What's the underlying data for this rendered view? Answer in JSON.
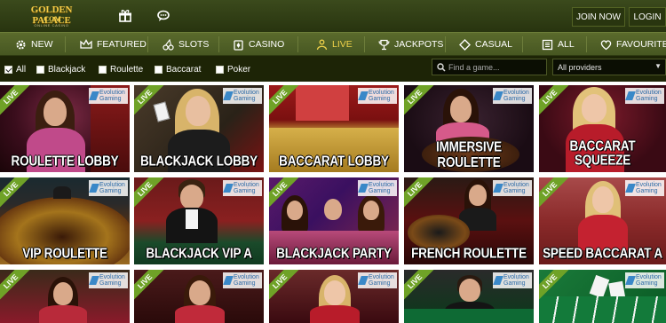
{
  "brand": {
    "line1": "GOLDEN PALACE",
    "line2": ".COM",
    "line3": "ONLINE CASINO"
  },
  "header": {
    "join_label": "JOIN NOW",
    "login_label": "LOGIN",
    "icons": [
      "gift-icon",
      "chat-icon"
    ]
  },
  "nav": {
    "items": [
      {
        "label": "NEW",
        "icon": "gear-icon"
      },
      {
        "label": "FEATURED",
        "icon": "crown-icon"
      },
      {
        "label": "SLOTS",
        "icon": "cherries-icon"
      },
      {
        "label": "CASINO",
        "icon": "cards-icon"
      },
      {
        "label": "LIVE",
        "icon": "dealer-icon",
        "active": true
      },
      {
        "label": "JACKPOTS",
        "icon": "trophy-icon"
      },
      {
        "label": "CASUAL",
        "icon": "diamond-icon"
      },
      {
        "label": "ALL",
        "icon": "list-icon"
      },
      {
        "label": "FAVOURITES",
        "icon": "heart-icon"
      }
    ]
  },
  "filters": {
    "options": [
      {
        "label": "All",
        "checked": true
      },
      {
        "label": "Blackjack",
        "checked": false
      },
      {
        "label": "Roulette",
        "checked": false
      },
      {
        "label": "Baccarat",
        "checked": false
      },
      {
        "label": "Poker",
        "checked": false
      }
    ],
    "search_placeholder": "Find a game...",
    "provider_selected": "All providers"
  },
  "tile_badge": {
    "live": "LIVE",
    "provider_line1": "Evolution",
    "provider_line2": "Gaming"
  },
  "games": {
    "row1": [
      "ROULETTE LOBBY",
      "BLACKJACK LOBBY",
      "BACCARAT LOBBY",
      "IMMERSIVE ROULETTE",
      "BACCARAT",
      "SQUEEZE"
    ],
    "row2": [
      "VIP ROULETTE",
      "BLACKJACK VIP A",
      "BLACKJACK PARTY",
      "FRENCH ROULETTE",
      "SPEED BACCARAT A"
    ]
  },
  "colors": {
    "header_bg": "#28340f",
    "nav_bg": "#4f5f26",
    "active_nav": "#f0d24a",
    "live_ribbon": "#6fa227",
    "title_text": "#ffffff"
  }
}
